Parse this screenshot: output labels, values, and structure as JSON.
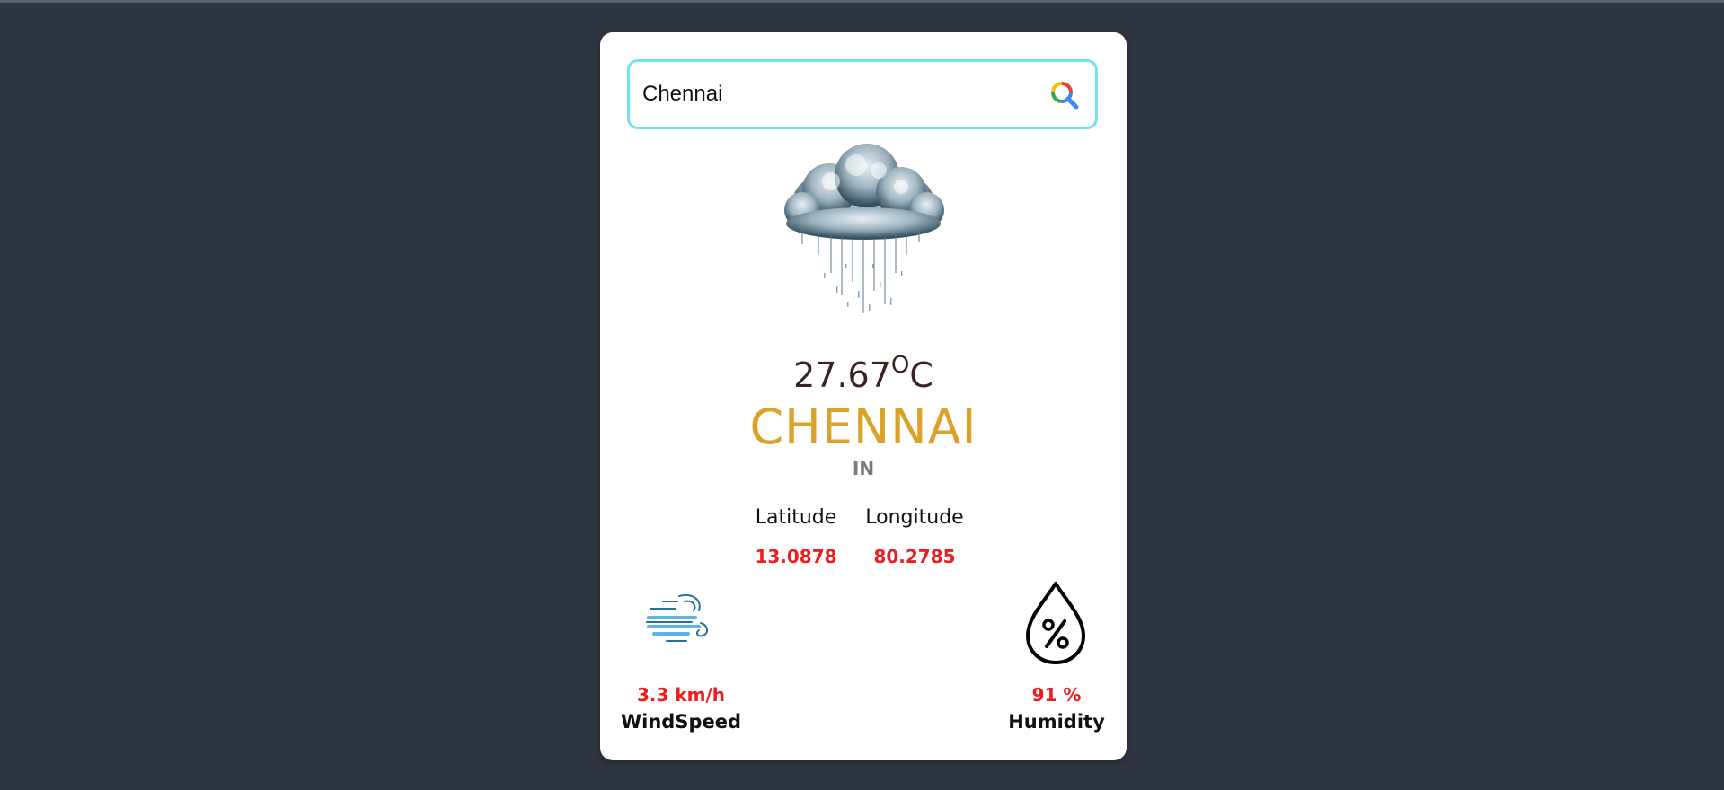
{
  "search": {
    "value": "Chennai",
    "placeholder": ""
  },
  "weather": {
    "condition_icon": "rain-cloud-icon",
    "temperature": "27.67",
    "temperature_unit_degree": "O",
    "temperature_unit": "C",
    "city": "CHENNAI",
    "country": "IN"
  },
  "coordinates": {
    "latitude_label": "Latitude",
    "longitude_label": "Longitude",
    "latitude": "13.0878",
    "longitude": "80.2785"
  },
  "stats": {
    "wind_value": "3.3 km/h",
    "wind_label": "WindSpeed",
    "humidity_value": "91 %",
    "humidity_label": "Humidity"
  },
  "colors": {
    "background": "#2f3540",
    "card": "#ffffff",
    "search_border": "#6fe3ee",
    "temperature": "#3a2422",
    "city": "#dba229",
    "country": "#7a7a7a",
    "value_red": "#ee1c1c"
  }
}
